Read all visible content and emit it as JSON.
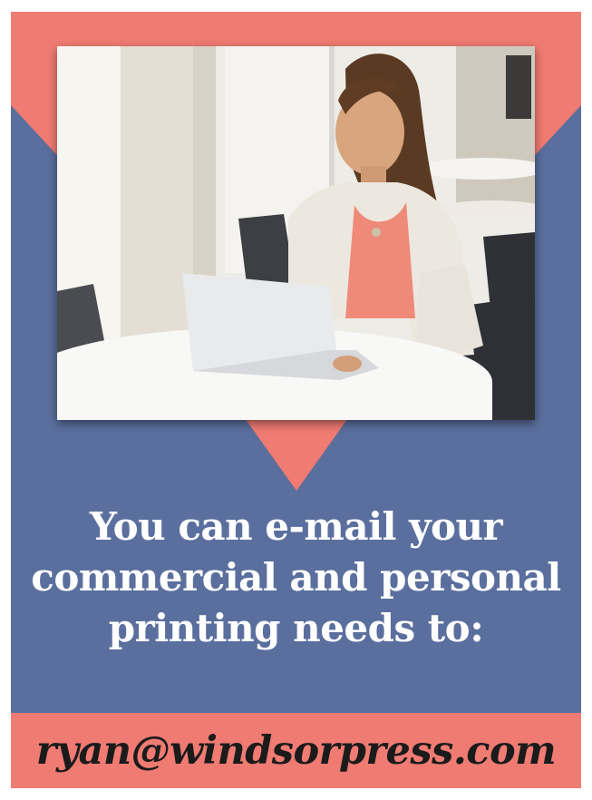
{
  "colors": {
    "coral": "#ef7b72",
    "navy": "#5a6f9e",
    "text_light": "#ffffff",
    "text_dark": "#1b1b1b"
  },
  "photo": {
    "subject": "woman-typing-on-laptop"
  },
  "headline": {
    "line1": "You can e-mail your",
    "line2": "commercial and personal",
    "line3": "printing needs to:"
  },
  "contact": {
    "email": "ryan@windsorpress.com"
  }
}
